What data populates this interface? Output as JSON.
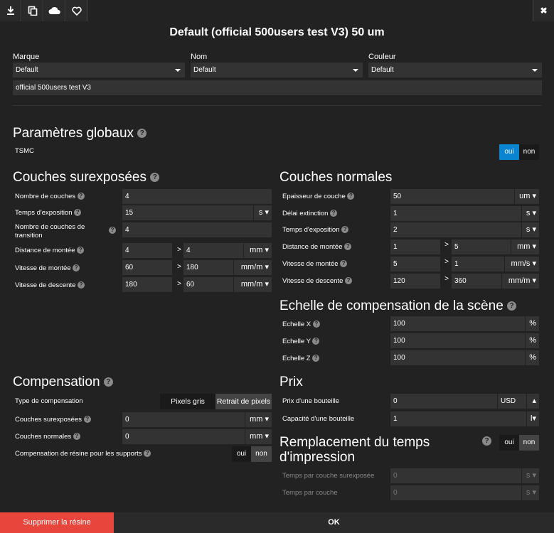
{
  "toolbar": {
    "download_icon": "download-icon",
    "copy_icon": "copy-icon",
    "cloud_icon": "cloud-icon",
    "heart_icon": "heart-icon",
    "close_icon": "close-icon",
    "close_glyph": "✖"
  },
  "title": "Default (official 500users test V3) 50 um",
  "header": {
    "brand_label": "Marque",
    "brand_value": "Default",
    "name_label": "Nom",
    "name_value": "Default",
    "color_label": "Couleur",
    "color_value": "Default",
    "description_value": "official 500users test V3"
  },
  "global": {
    "title": "Paramètres globaux",
    "tsmc_label": "TSMC",
    "yes": "oui",
    "no": "non"
  },
  "over": {
    "title": "Couches surexposées",
    "count_label": "Nombre de couches",
    "count_value": "4",
    "exposure_label": "Temps d'exposition",
    "exposure_value": "15",
    "exposure_unit": "s",
    "transition_label": "Nombre de couches de transition",
    "transition_value": "4",
    "lift_dist_label": "Distance de montée",
    "lift_dist_a": "4",
    "lift_dist_b": "4",
    "lift_dist_unit": "mm",
    "lift_speed_label": "Vitesse de montée",
    "lift_speed_a": "60",
    "lift_speed_b": "180",
    "lift_speed_unit": "mm/m",
    "retract_speed_label": "Vitesse de descente",
    "retract_speed_a": "180",
    "retract_speed_b": "60",
    "retract_speed_unit": "mm/m"
  },
  "normal": {
    "title": "Couches normales",
    "thickness_label": "Epaisseur de couche",
    "thickness_value": "50",
    "thickness_unit": "um",
    "delay_label": "Délai extinction",
    "delay_value": "1",
    "delay_unit": "s",
    "exposure_label": "Temps d'exposition",
    "exposure_value": "2",
    "exposure_unit": "s",
    "lift_dist_label": "Distance de montée",
    "lift_dist_a": "1",
    "lift_dist_b": "5",
    "lift_dist_unit": "mm",
    "lift_speed_label": "Vitesse de montée",
    "lift_speed_a": "5",
    "lift_speed_b": "1",
    "lift_speed_unit": "mm/s",
    "retract_speed_label": "Vitesse de descente",
    "retract_speed_a": "120",
    "retract_speed_b": "360",
    "retract_speed_unit": "mm/m"
  },
  "gt": ">",
  "scale": {
    "title": "Echelle de compensation de la scène",
    "x_label": "Echelle X",
    "x_value": "100",
    "y_label": "Echelle Y",
    "y_value": "100",
    "z_label": "Echelle Z",
    "z_value": "100",
    "unit": "%"
  },
  "compensation": {
    "title": "Compensation",
    "type_label": "Type de compensation",
    "opt_gray": "Pixels gris",
    "opt_retract": "Retrait de pixels",
    "over_label": "Couches surexposées",
    "over_value": "0",
    "over_unit": "mm",
    "normal_label": "Couches normales",
    "normal_value": "0",
    "normal_unit": "mm",
    "supports_label": "Compensation de résine pour les supports",
    "yes": "oui",
    "no": "non"
  },
  "price": {
    "title": "Prix",
    "bottle_price_label": "Prix d'une bouteille",
    "bottle_price_value": "0",
    "currency": "USD",
    "bottle_capacity_label": "Capacité d'une bouteille",
    "bottle_capacity_value": "1",
    "capacity_unit": "l"
  },
  "print_time": {
    "title": "Remplacement du temps d'impression",
    "yes": "oui",
    "no": "non",
    "over_label": "Temps par couche surexposée",
    "over_value": "0",
    "over_unit": "s",
    "layer_label": "Temps par couche",
    "layer_value": "0",
    "layer_unit": "s"
  },
  "footer": {
    "delete_label": "Supprimer la résine",
    "ok_label": "OK"
  },
  "colors": {
    "accent": "#0a84d0",
    "danger": "#e8453c",
    "bg": "#222222",
    "field": "#333333"
  }
}
